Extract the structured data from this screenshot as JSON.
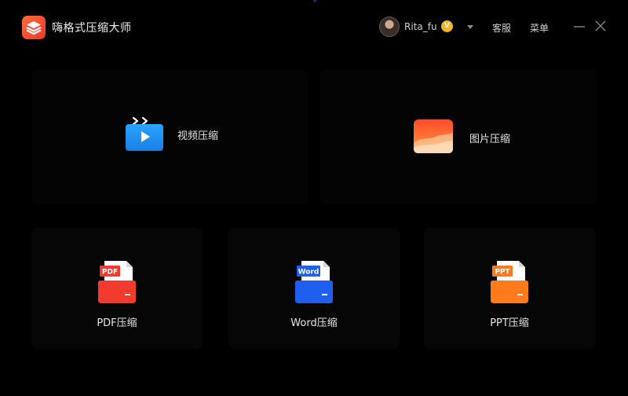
{
  "window": {
    "title": "嗨格式压缩大师"
  },
  "user": {
    "name": "Rita_fu",
    "badge": "V"
  },
  "titlebar": {
    "service_label": "客服",
    "menu_label": "菜单"
  },
  "features": {
    "video": {
      "label": "视频压缩",
      "icon": "video-play-icon"
    },
    "image": {
      "label": "图片压缩",
      "icon": "image-landscape-icon"
    },
    "pdf": {
      "label": "PDF压缩",
      "icon": "pdf-file-icon",
      "tag": "PDF"
    },
    "word": {
      "label": "Word压缩",
      "icon": "word-file-icon",
      "tag": "Word"
    },
    "ppt": {
      "label": "PPT压缩",
      "icon": "ppt-file-icon",
      "tag": "PPT"
    }
  },
  "colors": {
    "background": "#000000",
    "brand": "#f0442e",
    "video_blue": "#1f8ff0",
    "image_orange": "#ff7a2e",
    "pdf_red": "#f23a2f",
    "word_blue": "#1e5ff0",
    "ppt_orange": "#ff7a1a",
    "vip_gold": "#f3b32a"
  }
}
